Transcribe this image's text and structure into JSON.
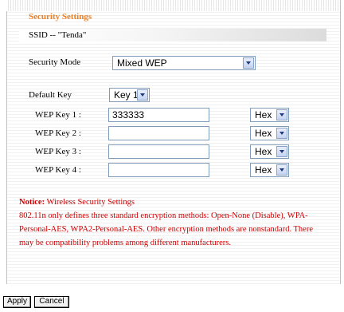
{
  "section_title": "Security Settings",
  "ssid_text": "SSID -- \"Tenda\"",
  "security_mode": {
    "label": "Security Mode",
    "value": "Mixed WEP"
  },
  "default_key": {
    "label": "Default Key",
    "value": "Key 1"
  },
  "wep_keys": [
    {
      "label": "WEP Key 1 :",
      "value": "333333",
      "format": "Hex"
    },
    {
      "label": "WEP Key 2 :",
      "value": "",
      "format": "Hex"
    },
    {
      "label": "WEP Key 3 :",
      "value": "",
      "format": "Hex"
    },
    {
      "label": "WEP Key 4 :",
      "value": "",
      "format": "Hex"
    }
  ],
  "notice": {
    "heading": "Notice:",
    "title": " Wireless Security Settings",
    "body": "802.11n only defines three standard encryption methods: Open-None (Disable), WPA- Personal-AES, WPA2-Personal-AES. Other encryption methods are nonstandard. There may be compatibility problems among different manufacturers."
  },
  "buttons": {
    "apply": "Apply",
    "cancel": "Cancel"
  },
  "colors": {
    "title": "#e8802a",
    "notice": "#cc0000",
    "field_border": "#7f9db9"
  }
}
